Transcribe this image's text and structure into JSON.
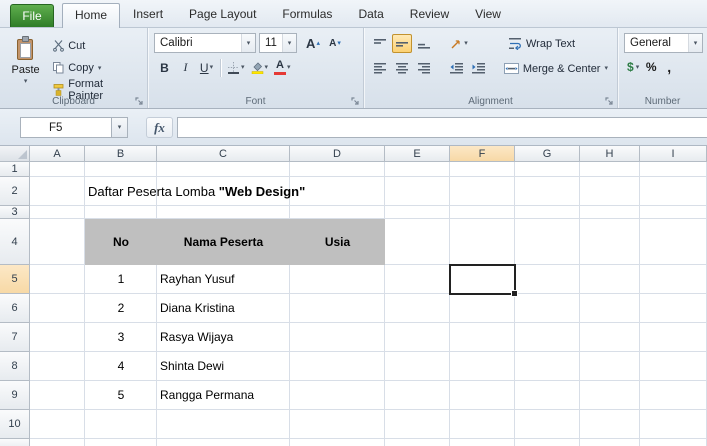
{
  "tabs": {
    "file": "File",
    "home": "Home",
    "insert": "Insert",
    "page_layout": "Page Layout",
    "formulas": "Formulas",
    "data": "Data",
    "review": "Review",
    "view": "View"
  },
  "ribbon": {
    "clipboard": {
      "label": "Clipboard",
      "paste": "Paste",
      "cut": "Cut",
      "copy": "Copy",
      "format_painter": "Format Painter"
    },
    "font": {
      "label": "Font",
      "family": "Calibri",
      "size": "11",
      "bold": "B",
      "italic": "I",
      "underline": "U",
      "grow": "A",
      "shrink": "A",
      "color_letter": "A"
    },
    "alignment": {
      "label": "Alignment",
      "wrap_text": "Wrap Text",
      "merge_center": "Merge & Center"
    },
    "number": {
      "label": "Number",
      "format": "General",
      "currency": "$",
      "percent": "%",
      "comma": ","
    }
  },
  "formula_bar": {
    "name_box": "F5",
    "fx": "fx",
    "formula": ""
  },
  "sheet": {
    "col_headers": [
      "A",
      "B",
      "C",
      "D",
      "E",
      "F",
      "G",
      "H",
      "I"
    ],
    "row_headers": [
      "1",
      "2",
      "3",
      "4",
      "5",
      "6",
      "7",
      "8",
      "9",
      "10"
    ],
    "active_col": "F",
    "active_row": "5",
    "selected_cell": "F5",
    "title": {
      "text": "Daftar Peserta Lomba ",
      "highlight": "\"Web Design\""
    },
    "table": {
      "headers": {
        "no": "No",
        "nama": "Nama Peserta",
        "usia": "Usia"
      },
      "rows": [
        {
          "no": "1",
          "nama": "Rayhan Yusuf",
          "usia": ""
        },
        {
          "no": "2",
          "nama": "Diana Kristina",
          "usia": ""
        },
        {
          "no": "3",
          "nama": "Rasya Wijaya",
          "usia": ""
        },
        {
          "no": "4",
          "nama": "Shinta Dewi",
          "usia": ""
        },
        {
          "no": "5",
          "nama": "Rangga Permana",
          "usia": ""
        }
      ]
    }
  },
  "colors": {
    "file_tab_green": "#2F7D27",
    "table_header_fill": "#BFBFBF",
    "fill_swatch": "#FFE600",
    "font_color_swatch": "#E53935",
    "active_align_highlight": "#FCD173"
  }
}
